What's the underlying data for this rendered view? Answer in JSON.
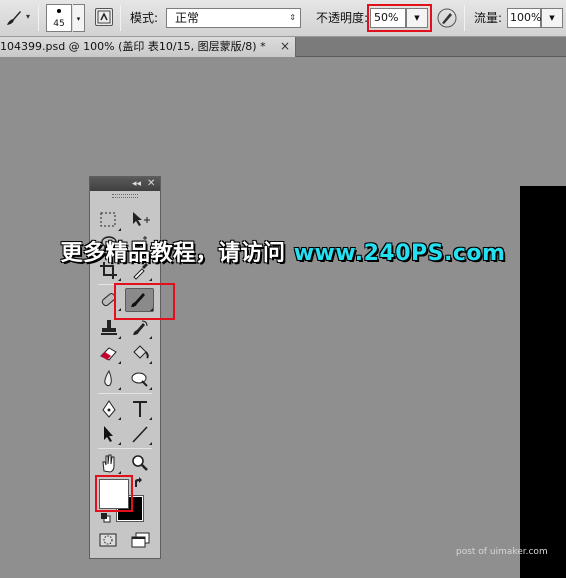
{
  "options_bar": {
    "brush_size": "45",
    "mode_label": "模式:",
    "mode_value": "正常",
    "opacity_label": "不透明度:",
    "opacity_value": "50%",
    "flow_label": "流量:",
    "flow_value": "100%",
    "icons": [
      "brush-tool-icon",
      "brush-panel-icon",
      "airbrush-icon"
    ]
  },
  "document_tab": {
    "title": "104399.psd @ 100% (盖印 表10/15, 图层蒙版/8) *",
    "close": "×"
  },
  "tools_panel": {
    "collapse": "◂◂",
    "close": "✕",
    "active_tool": "brush-tool",
    "foreground_color": "#ffffff",
    "background_color": "#000000",
    "tools": [
      "marquee-tool",
      "move-tool",
      "lasso-tool",
      "magic-wand-tool",
      "crop-tool",
      "eyedropper-tool",
      "healing-brush-tool",
      "brush-tool",
      "clone-stamp-tool",
      "history-brush-tool",
      "eraser-tool",
      "paint-bucket-tool",
      "blur-tool",
      "dodge-tool",
      "pen-tool",
      "type-tool",
      "path-selection-tool",
      "line-tool",
      "hand-tool",
      "zoom-tool"
    ]
  },
  "watermark": {
    "text": "更多精品教程，请访问 ",
    "url": "www.240PS.com"
  },
  "credit": "post of uimaker.com",
  "highlight_color": "#e3101c"
}
